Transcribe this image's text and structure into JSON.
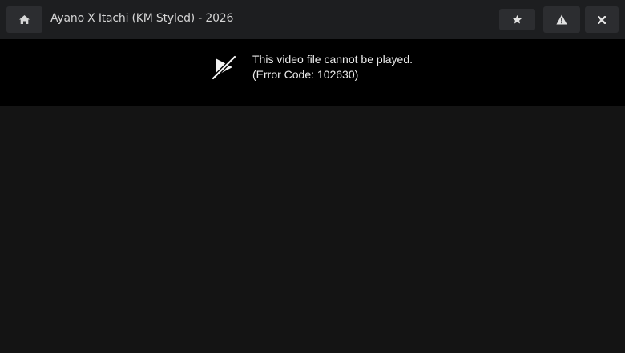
{
  "header": {
    "title": "Ayano X Itachi (KM Styled) - 2026",
    "buttons": {
      "home_icon": "home-icon",
      "favorite_icon": "star-icon",
      "report_icon": "warning-icon",
      "close_icon": "close-icon"
    }
  },
  "player": {
    "error_icon": "video-unavailable-icon",
    "error_message": "This video file cannot be played.",
    "error_code": "(Error Code: 102630)"
  },
  "colors": {
    "topbar_bg": "#1d1e20",
    "button_bg": "#2c2d30",
    "player_bg": "#000000",
    "page_bg": "#141414",
    "text": "#ececec"
  }
}
